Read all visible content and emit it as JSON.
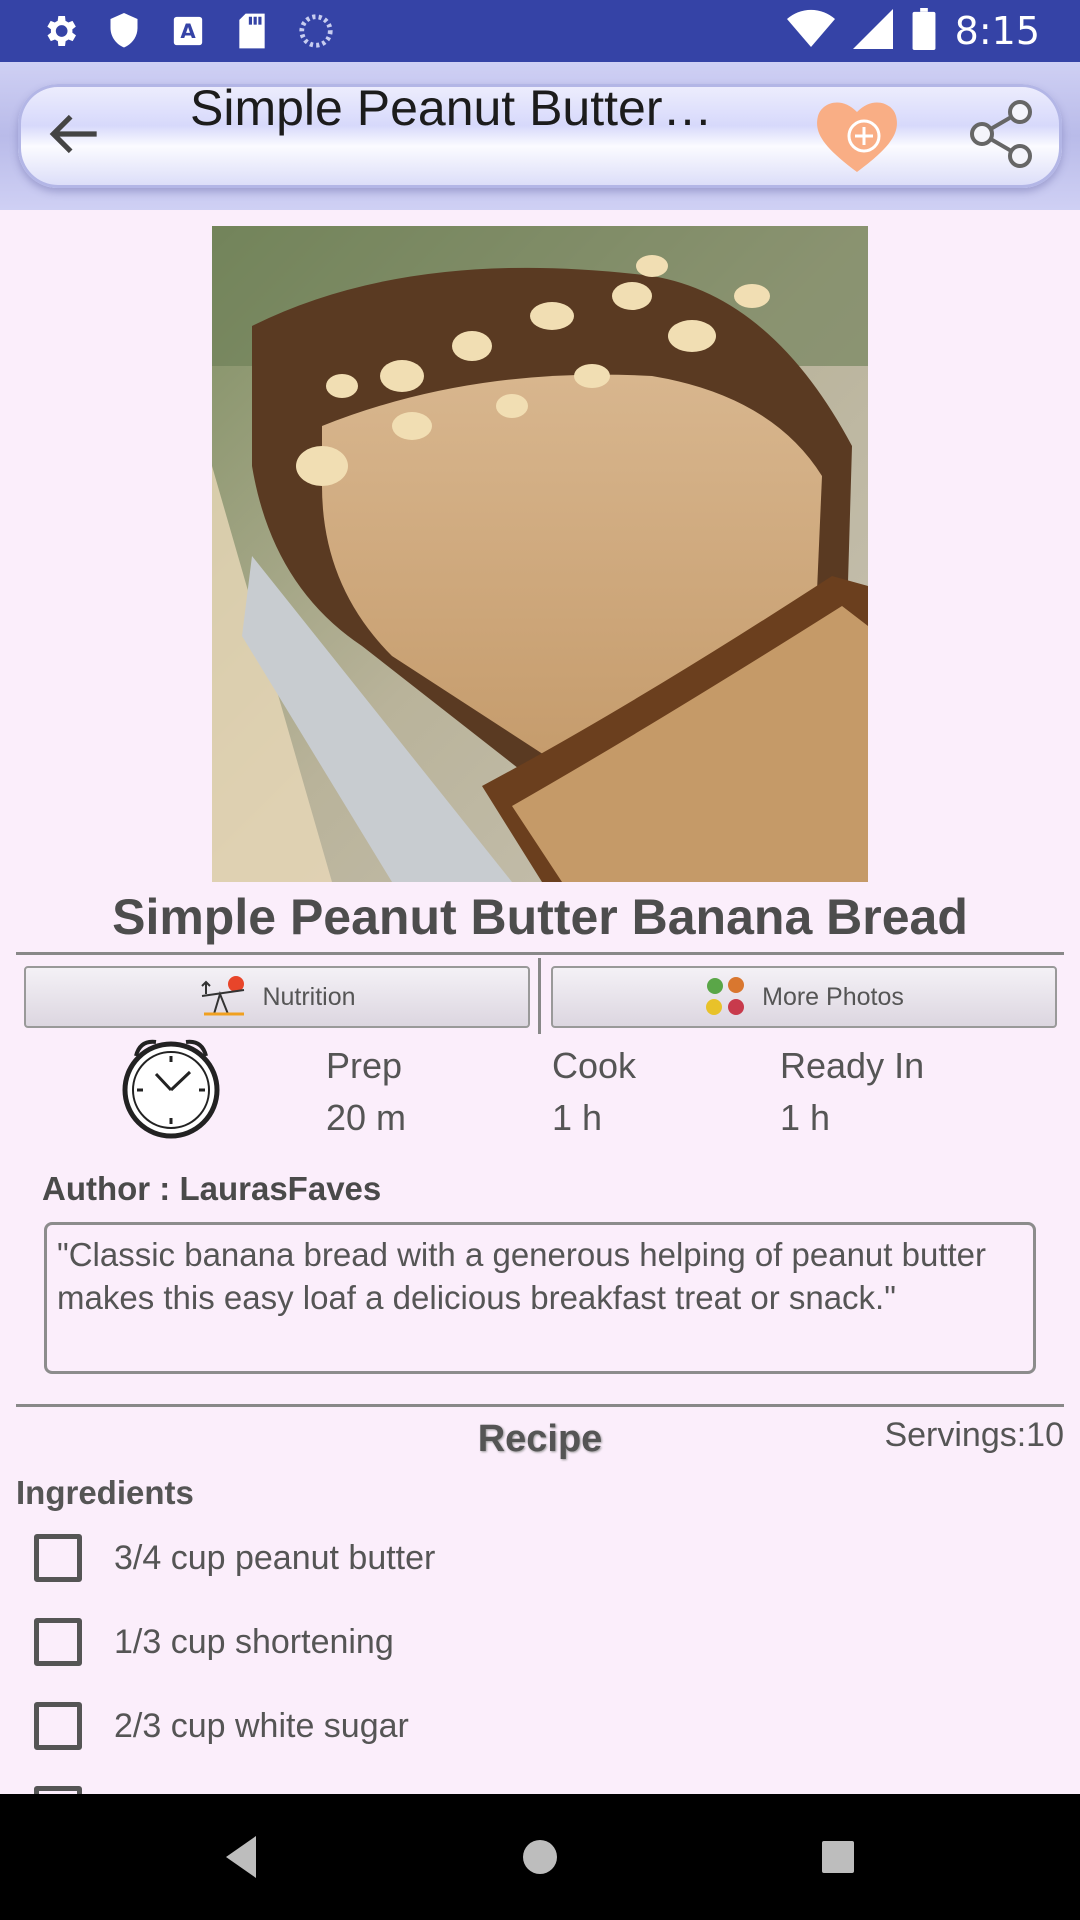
{
  "status_bar": {
    "icons": [
      "settings-icon",
      "shield-icon",
      "text-a-icon",
      "sd-card-icon",
      "loading-icon"
    ],
    "time": "8:15"
  },
  "toolbar": {
    "title": "Simple Peanut Butter…"
  },
  "recipe": {
    "title": "Simple Peanut Butter Banana Bread",
    "buttons": {
      "nutrition": "Nutrition",
      "more_photos": "More Photos"
    },
    "timing": {
      "prep_label": "Prep",
      "prep_value": "20 m",
      "cook_label": "Cook",
      "cook_value": "1 h",
      "ready_label": "Ready In",
      "ready_value": "1 h"
    },
    "author": "Author : LaurasFaves",
    "description": "\"Classic banana bread with a generous helping of peanut butter makes this easy loaf a delicious breakfast treat or snack.\"",
    "section_title": "Recipe",
    "servings": "Servings:10",
    "ingredients_label": "Ingredients",
    "ingredients": [
      "3/4 cup peanut butter",
      "1/3 cup shortening",
      "2/3 cup white sugar"
    ]
  },
  "colors": {
    "status_bar": "#3543a6",
    "background": "#fbeefb",
    "favorite": "#f9ae85"
  }
}
